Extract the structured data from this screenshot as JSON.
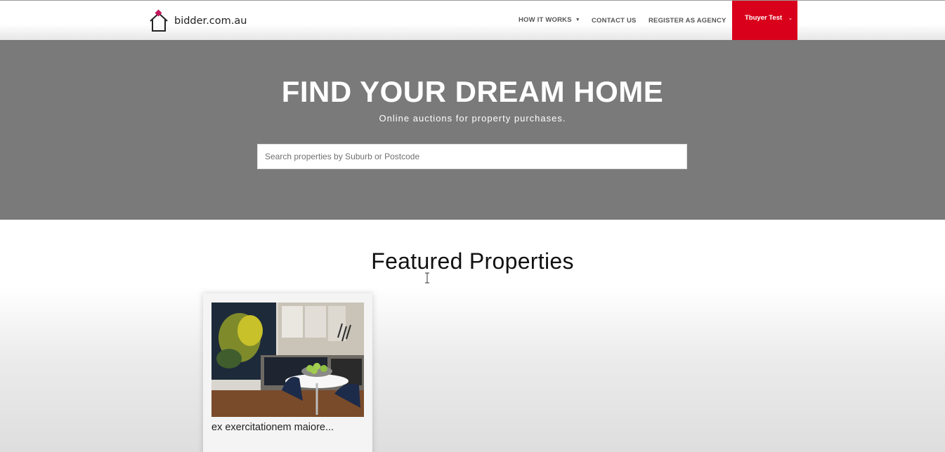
{
  "header": {
    "logo_text": "bidder.com.au",
    "logo_icon": "house-gavel-icon",
    "nav": {
      "how_it_works": "HOW IT WORKS",
      "contact_us": "CONTACT US",
      "register_as_agency": "REGISTER AS AGENCY"
    },
    "user_menu_label": "Tbuyer Test",
    "accent_color": "#d9001b"
  },
  "hero": {
    "title": "FIND YOUR DREAM HOME",
    "subtitle": "Online auctions for property purchases.",
    "search_placeholder": "Search properties by Suburb or Postcode",
    "background_color": "#7a7a7a"
  },
  "featured": {
    "heading": "Featured Properties",
    "cards": [
      {
        "title": "ex exercitationem maiore..."
      }
    ]
  }
}
